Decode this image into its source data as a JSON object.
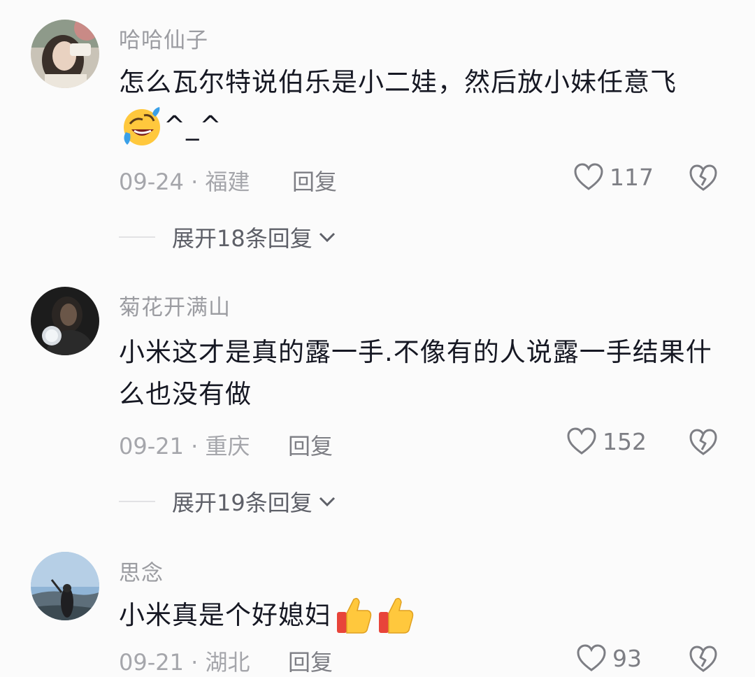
{
  "comments": [
    {
      "username": "哈哈仙子",
      "text": "怎么瓦尔特说伯乐是小二娃，然后放小妹任意飞",
      "text_line2_suffix": "^_^",
      "line2_emoji": "face-with-tears-of-joy-icon",
      "date": "09-24",
      "location": "福建",
      "reply_label": "回复",
      "like_count": "117",
      "expand_label": "展开18条回复"
    },
    {
      "username": "菊花开满山",
      "text": "小米这才是真的露一手.不像有的人说露一手结果什么也没有做",
      "date": "09-21",
      "location": "重庆",
      "reply_label": "回复",
      "like_count": "152",
      "expand_label": "展开19条回复"
    },
    {
      "username": "思念",
      "text": "小米真是个好媳妇",
      "emojis": [
        "thumbs-up-icon",
        "thumbs-up-icon"
      ],
      "date": "09-21",
      "location": "湖北",
      "reply_label": "回复",
      "like_count": "93"
    }
  ],
  "colors": {
    "background": "#fbfbfb",
    "text": "#161823",
    "secondary": "#9b9ca1",
    "icon": "#7d7e84"
  }
}
